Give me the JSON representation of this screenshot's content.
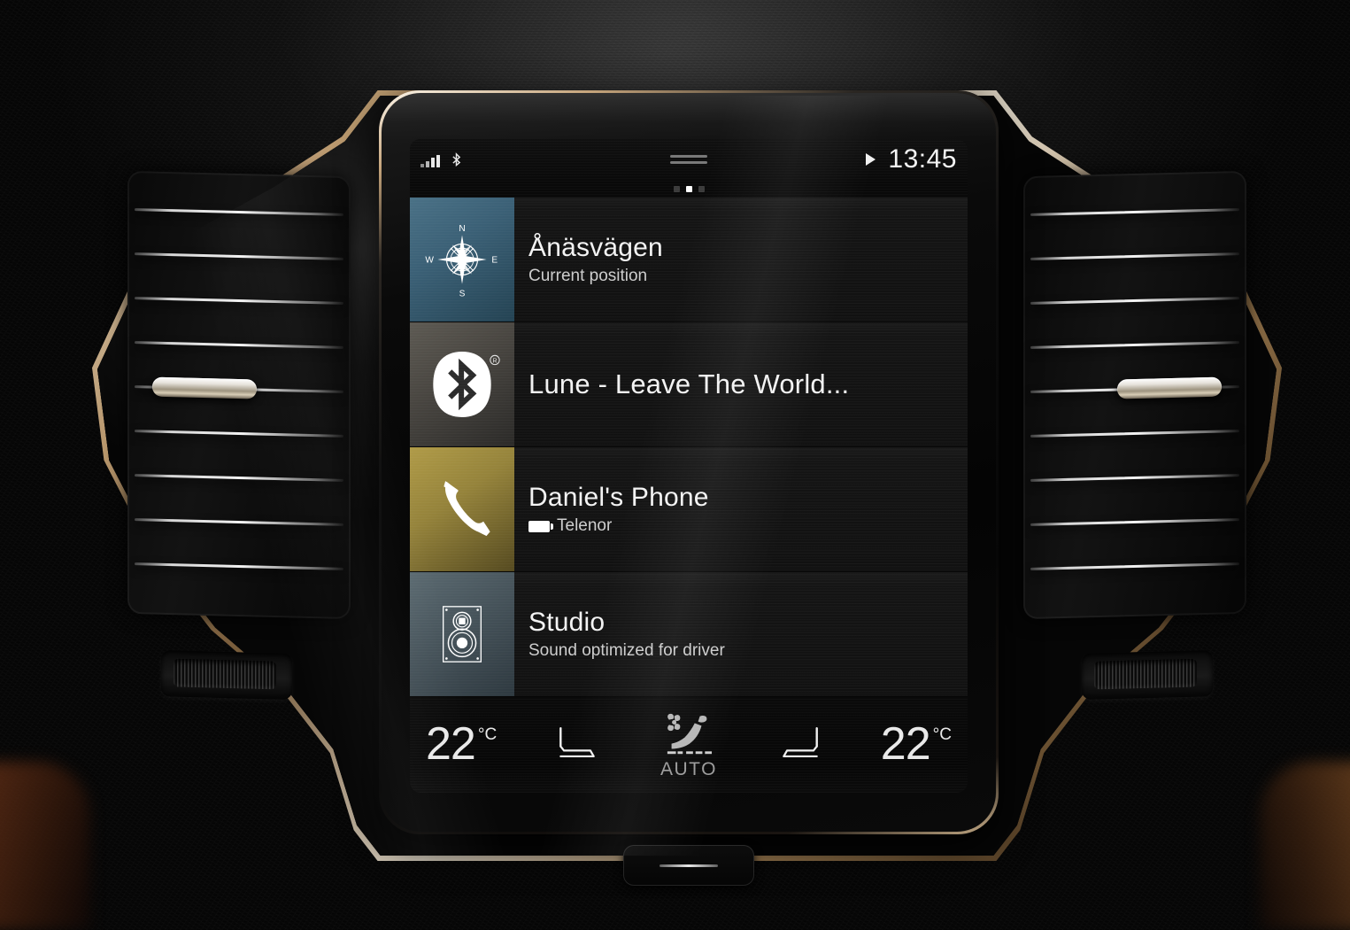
{
  "status_bar": {
    "signal_icon": "signal-bars-icon",
    "bluetooth_icon": "bluetooth-icon",
    "menu_handle_icon": "menu-handle-icon",
    "play_icon": "play-icon",
    "time": "13:45"
  },
  "page_indicator": {
    "count": 3,
    "active_index": 1
  },
  "tiles": [
    {
      "key": "navigation",
      "icon": "compass-rose-icon",
      "title": "Ånäsvägen",
      "subtitle": "Current position",
      "icon_bg": "#3b6076",
      "compass_labels": {
        "north": "N",
        "east": "E",
        "south": "S",
        "west": "W"
      }
    },
    {
      "key": "media",
      "icon": "bluetooth-icon",
      "title": "Lune - Leave The World...",
      "subtitle": "",
      "icon_bg": "#494641",
      "trademark": "®"
    },
    {
      "key": "phone",
      "icon": "phone-handset-icon",
      "title": "Daniel's Phone",
      "subtitle": "Telenor",
      "subtitle_icon": "battery-icon",
      "icon_bg": "#95833b"
    },
    {
      "key": "sound",
      "icon": "speaker-icon",
      "title": "Studio",
      "subtitle": "Sound optimized for driver",
      "icon_bg": "#48555c"
    }
  ],
  "climate": {
    "left_temp": "22",
    "left_unit": "°C",
    "right_temp": "22",
    "right_unit": "°C",
    "left_seat_icon": "seat-icon",
    "right_seat_icon": "seat-icon",
    "center_icon": "auto-climate-seat-icon",
    "auto_label": "AUTO"
  },
  "hardware": {
    "home_button": "home-button",
    "left_vent": "air-vent-left",
    "right_vent": "air-vent-right",
    "left_knob": "vent-knob-left",
    "right_knob": "vent-knob-right"
  }
}
